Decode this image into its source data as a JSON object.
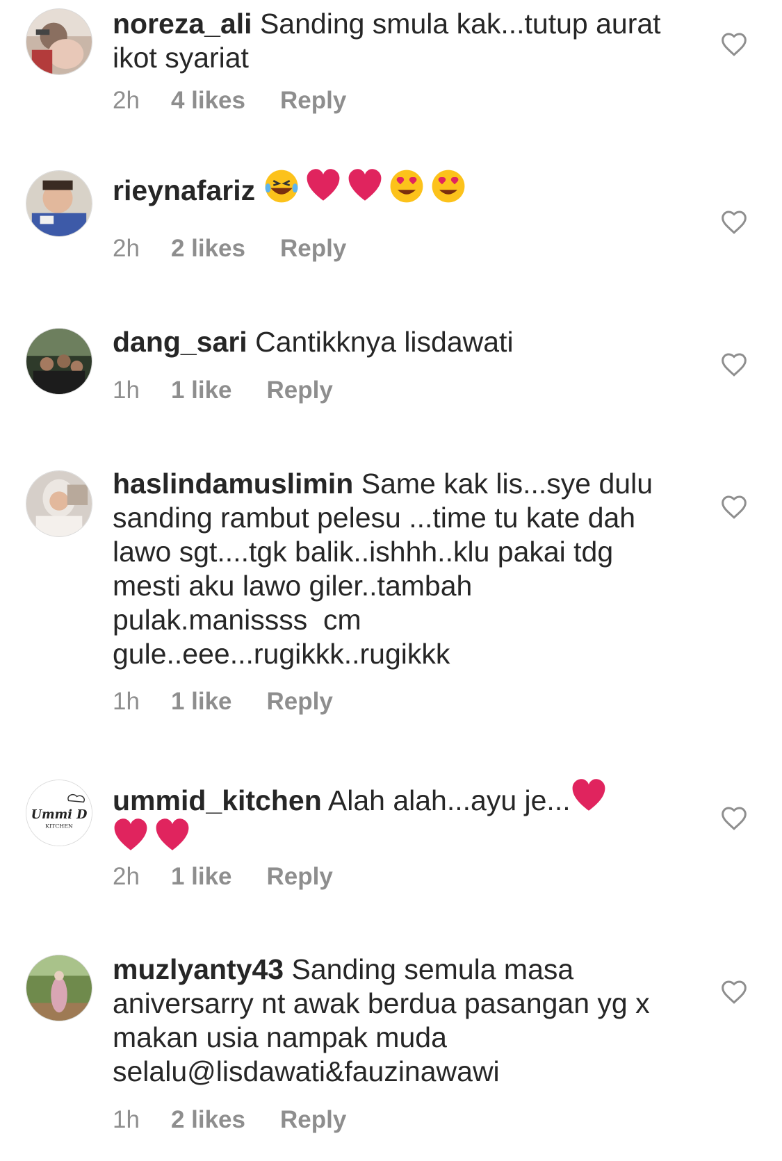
{
  "comments": [
    {
      "username": "noreza_ali",
      "text": "Sanding smula kak...tutup aurat ikot syariat",
      "time": "2h",
      "likes": "4 likes",
      "reply": "Reply",
      "avatar": "photo of woman with child"
    },
    {
      "username": "rieynafariz",
      "text": "",
      "emojis": [
        "laughing-tears-emoji",
        "red-heart-emoji",
        "red-heart-emoji",
        "heart-eyes-emoji",
        "heart-eyes-emoji"
      ],
      "time": "2h",
      "likes": "2 likes",
      "reply": "Reply",
      "avatar": "photo of baby"
    },
    {
      "username": "dang_sari",
      "text": "Cantikknya lisdawati",
      "time": "1h",
      "likes": "1 like",
      "reply": "Reply",
      "avatar": "group photo outdoors"
    },
    {
      "username": "haslindamuslimin",
      "text": "Same kak lis...sye dulu sanding rambut pelesu ...time tu kate dah lawo sgt....tgk balik..ishhh..klu pakai tdg mesti aku lawo giler..tambah pulak.manissss  cm gule..eee...rugikkk..rugikkk",
      "time": "1h",
      "likes": "1 like",
      "reply": "Reply",
      "avatar": "photo of woman in hijab"
    },
    {
      "username": "ummid_kitchen",
      "text": "Alah alah...ayu je...",
      "emojis": [
        "red-heart-emoji",
        "red-heart-emoji",
        "red-heart-emoji"
      ],
      "time": "2h",
      "likes": "1 like",
      "reply": "Reply",
      "avatar": "Ummi D Kitchen logo",
      "logo_text": "Ummi D",
      "logo_subtext": "KITCHEN"
    },
    {
      "username": "muzlyanty43",
      "text": "Sanding semula masa aniversarry nt awak berdua pasangan yg x makan usia nampak muda selalu@lisdawati&fauzinawawi",
      "time": "1h",
      "likes": "2 likes",
      "reply": "Reply",
      "avatar": "photo of woman in park"
    }
  ],
  "colors": {
    "text": "#262626",
    "meta": "#8e8e8e",
    "heart_emoji": "#e0245e"
  }
}
